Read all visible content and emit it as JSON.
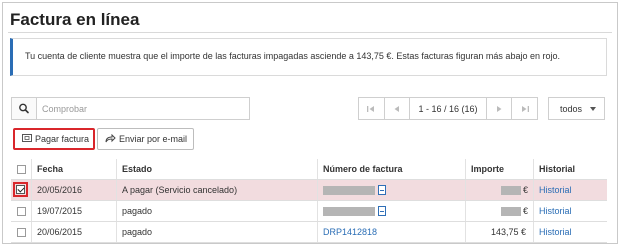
{
  "page": {
    "title": "Factura en línea"
  },
  "notice": {
    "text": "Tu cuenta de cliente muestra que el importe de las facturas impagadas asciende a 143,75 €. Estas facturas figuran más abajo en rojo."
  },
  "search": {
    "placeholder": "Comprobar",
    "value": ""
  },
  "pagination": {
    "range_label": "1 - 16 / 16 (16)"
  },
  "filter": {
    "selected": "todos"
  },
  "actions": {
    "pay_label": "Pagar factura",
    "email_label": "Enviar por e-mail"
  },
  "table": {
    "columns": {
      "fecha": "Fecha",
      "estado": "Estado",
      "numero": "Número de factura",
      "importe": "Importe",
      "historial": "Historial"
    },
    "rows": [
      {
        "fecha": "20/05/2016",
        "estado": "A pagar (Servicio cancelado)",
        "importe": "€",
        "historial": "Historial",
        "checked": true,
        "highlight": true
      },
      {
        "fecha": "19/07/2015",
        "estado": "pagado",
        "importe": "€",
        "historial": "Historial",
        "checked": false,
        "highlight": false
      },
      {
        "fecha": "20/06/2015",
        "estado": "pagado",
        "numero": "DRP1412818",
        "importe": "143,75 €",
        "historial": "Historial",
        "checked": false,
        "highlight": false
      }
    ]
  }
}
